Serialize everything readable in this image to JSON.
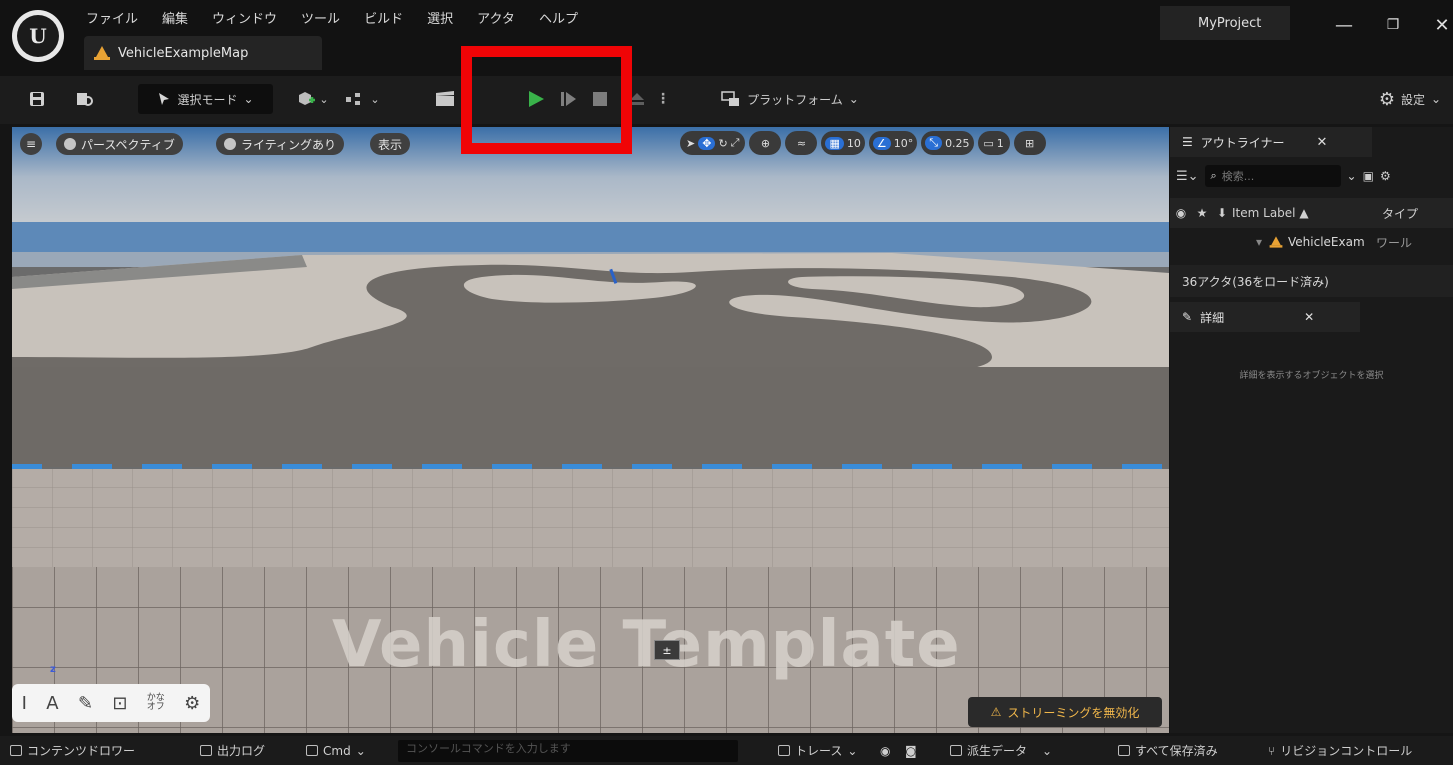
{
  "window": {
    "project": "MyProject",
    "minimize": "—",
    "maximize": "❐",
    "close": "✕",
    "logo": "U"
  },
  "menu": [
    "ファイル",
    "編集",
    "ウィンドウ",
    "ツール",
    "ビルド",
    "選択",
    "アクタ",
    "ヘルプ"
  ],
  "tab": {
    "label": "VehicleExampleMap"
  },
  "toolbar": {
    "select_mode": "選択モード",
    "platform": "プラットフォーム",
    "settings": "設定"
  },
  "viewport": {
    "perspective": "パースペクティブ",
    "lighting": "ライティングあり",
    "show": "表示",
    "grid_snap": "10",
    "angle_snap": "10°",
    "scale_snap": "0.25",
    "camera_speed": "1",
    "overlay_text": "Vehicle Template",
    "streaming_warning": "ストリーミングを無効化",
    "axis_label": "z",
    "ime_mode_top": "かな",
    "ime_mode_bottom": "オフ"
  },
  "outliner": {
    "title": "アウトライナー",
    "search_placeholder": "検索...",
    "col_label": "Item Label",
    "col_type": "タイプ",
    "row_label": "VehicleExam",
    "row_type": "ワール",
    "actor_count": "36アクタ(36をロード済み)"
  },
  "details": {
    "title": "詳細",
    "empty_message": "詳細を表示するオブジェクトを選択"
  },
  "statusbar": {
    "content_drawer": "コンテンツドロワー",
    "output_log": "出力ログ",
    "cmd": "Cmd",
    "console_placeholder": "コンソールコマンドを入力します",
    "trace": "トレース",
    "derived_data": "派生データ",
    "all_saved": "すべて保存済み",
    "revision_control": "リビジョンコントロール"
  },
  "colors": {
    "highlight": "#f00406",
    "play": "#39b24a",
    "accent_blue": "#2a6fd4",
    "warning": "#f2b84b"
  },
  "icons": [
    "unreal-logo-icon",
    "save-icon",
    "content-browser-icon",
    "add-actor-icon",
    "blueprint-icon",
    "cinematics-icon",
    "play-icon",
    "step-icon",
    "stop-icon",
    "eject-icon",
    "platform-icon",
    "gear-icon",
    "filter-icon",
    "search-icon",
    "eye-icon",
    "star-icon",
    "pin-icon",
    "details-icon",
    "warning-icon"
  ]
}
